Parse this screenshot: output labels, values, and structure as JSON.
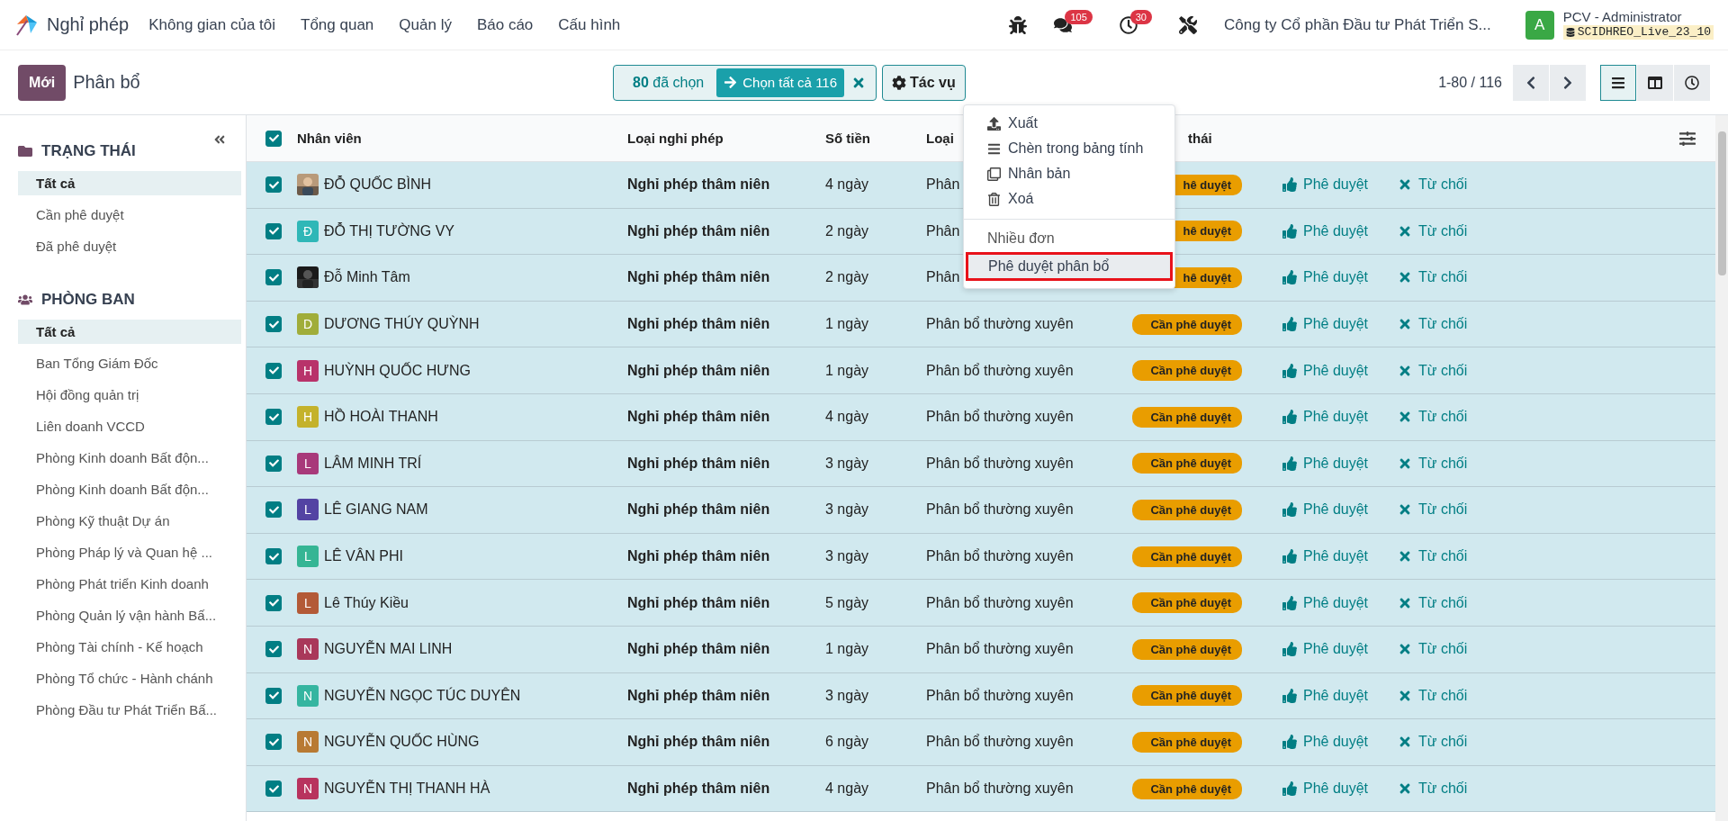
{
  "app": {
    "name": "Nghỉ phép"
  },
  "menu": [
    "Không gian của tôi",
    "Tổng quan",
    "Quản lý",
    "Báo cáo",
    "Cấu hình"
  ],
  "systray": {
    "messages_count": "105",
    "activities_count": "30",
    "company": "Công ty Cổ phần Đầu tư Phát Triển S...",
    "user_initial": "A",
    "user": "PCV - Administrator",
    "database": "SCIDHREO_Live_23_10"
  },
  "control": {
    "new_button": "Mới",
    "breadcrumb": "Phân bổ",
    "selected_count": "80",
    "selected_label": "đã chọn",
    "select_all": "Chọn tất cả 116",
    "actions": "Tác vụ",
    "pager": "1-80 / 116"
  },
  "views": [
    {
      "kind": "list",
      "selected": true
    },
    {
      "kind": "kanban",
      "selected": false
    },
    {
      "kind": "activity",
      "selected": false
    }
  ],
  "actions_menu": {
    "items": [
      {
        "kind": "export",
        "label": "Xuất",
        "highlighted": false
      },
      {
        "kind": "spreadsheet",
        "label": "Chèn trong bảng tính",
        "highlighted": false
      },
      {
        "kind": "duplicate",
        "label": "Nhân bản",
        "highlighted": false
      },
      {
        "kind": "delete",
        "label": "Xoá",
        "highlighted": false
      }
    ],
    "section": "Nhiều đơn",
    "section_items": [
      {
        "label": "Phê duyệt phân bổ",
        "highlighted": true
      }
    ]
  },
  "sidebar": {
    "groups": [
      {
        "kind": "folder",
        "title": "TRẠNG THÁI",
        "items": [
          {
            "label": "Tất cả",
            "selected": true
          },
          {
            "label": "Cần phê duyệt",
            "selected": false
          },
          {
            "label": "Đã phê duyệt",
            "selected": false
          }
        ]
      },
      {
        "kind": "users",
        "title": "PHÒNG BAN",
        "items": [
          {
            "label": "Tất cả",
            "selected": true
          },
          {
            "label": "Ban Tổng Giám Đốc",
            "selected": false
          },
          {
            "label": "Hội đồng quản trị",
            "selected": false
          },
          {
            "label": "Liên doanh VCCD",
            "selected": false
          },
          {
            "label": "Phòng Kinh doanh Bất độn...",
            "selected": false
          },
          {
            "label": "Phòng Kinh doanh Bất độn...",
            "selected": false
          },
          {
            "label": "Phòng Kỹ thuật Dự án",
            "selected": false
          },
          {
            "label": "Phòng Pháp lý và Quan hệ ...",
            "selected": false
          },
          {
            "label": "Phòng Phát triển Kinh doanh",
            "selected": false
          },
          {
            "label": "Phòng Quản lý vận hành Bấ...",
            "selected": false
          },
          {
            "label": "Phòng Tài chính - Kế hoạch",
            "selected": false
          },
          {
            "label": "Phòng Tổ chức - Hành chánh",
            "selected": false
          },
          {
            "label": "Phòng Đầu tư Phát Triển Bấ...",
            "selected": false
          }
        ]
      }
    ]
  },
  "table": {
    "header_checked": true,
    "columns": [
      "Nhân viên",
      "Loại nghỉ phép",
      "Số tiền",
      "Loại",
      "thái"
    ],
    "rows": [
      {
        "checked": true,
        "employee": "ĐỖ QUỐC BÌNH",
        "leave_type": "Nghỉ phép thâm niên",
        "amount": "4 ngày",
        "allocation_type": "Phân",
        "status": "hê duyệt",
        "approve": "Phê duyệt",
        "refuse": "Từ chối"
      },
      {
        "checked": true,
        "avatar": {
          "kind": "letter",
          "letter": "Đ",
          "color": "#2fb7b7"
        },
        "employee": "ĐỖ THỊ TƯỜNG VY",
        "leave_type": "Nghỉ phép thâm niên",
        "amount": "2 ngày",
        "allocation_type": "Phân",
        "status": "hê duyệt",
        "approve": "Phê duyệt",
        "refuse": "Từ chối"
      },
      {
        "checked": true,
        "employee": "Đỗ Minh Tâm",
        "leave_type": "Nghỉ phép thâm niên",
        "amount": "2 ngày",
        "allocation_type": "Phân",
        "status": "hê duyệt",
        "approve": "Phê duyệt",
        "refuse": "Từ chối"
      },
      {
        "checked": true,
        "avatar": {
          "kind": "letter",
          "letter": "D",
          "color": "#a0ad3a"
        },
        "employee": "DƯƠNG THÚY QUỲNH",
        "leave_type": "Nghỉ phép thâm niên",
        "amount": "1 ngày",
        "allocation_type": "Phân bổ thường xuyên",
        "status": "Cần phê duyệt",
        "approve": "Phê duyệt",
        "refuse": "Từ chối"
      },
      {
        "checked": true,
        "avatar": {
          "kind": "letter",
          "letter": "H",
          "color": "#b8336a"
        },
        "employee": "HUỲNH QUỐC HƯNG",
        "leave_type": "Nghỉ phép thâm niên",
        "amount": "1 ngày",
        "allocation_type": "Phân bổ thường xuyên",
        "status": "Cần phê duyệt",
        "approve": "Phê duyệt",
        "refuse": "Từ chối"
      },
      {
        "checked": true,
        "avatar": {
          "kind": "letter",
          "letter": "H",
          "color": "#c4b22b"
        },
        "employee": "HỒ HOÀI THANH",
        "leave_type": "Nghỉ phép thâm niên",
        "amount": "4 ngày",
        "allocation_type": "Phân bổ thường xuyên",
        "status": "Cần phê duyệt",
        "approve": "Phê duyệt",
        "refuse": "Từ chối"
      },
      {
        "checked": true,
        "avatar": {
          "kind": "letter",
          "letter": "L",
          "color": "#a8397a"
        },
        "employee": "LÂM MINH TRÍ",
        "leave_type": "Nghỉ phép thâm niên",
        "amount": "3 ngày",
        "allocation_type": "Phân bổ thường xuyên",
        "status": "Cần phê duyệt",
        "approve": "Phê duyệt",
        "refuse": "Từ chối"
      },
      {
        "checked": true,
        "avatar": {
          "kind": "letter",
          "letter": "L",
          "color": "#5343a3"
        },
        "employee": "LÊ GIANG NAM",
        "leave_type": "Nghỉ phép thâm niên",
        "amount": "3 ngày",
        "allocation_type": "Phân bổ thường xuyên",
        "status": "Cần phê duyệt",
        "approve": "Phê duyệt",
        "refuse": "Từ chối"
      },
      {
        "checked": true,
        "avatar": {
          "kind": "letter",
          "letter": "L",
          "color": "#35b594"
        },
        "employee": "LÊ VÂN PHI",
        "leave_type": "Nghỉ phép thâm niên",
        "amount": "3 ngày",
        "allocation_type": "Phân bổ thường xuyên",
        "status": "Cần phê duyệt",
        "approve": "Phê duyệt",
        "refuse": "Từ chối"
      },
      {
        "checked": true,
        "avatar": {
          "kind": "letter",
          "letter": "L",
          "color": "#b35a37"
        },
        "employee": "Lê Thúy Kiều",
        "leave_type": "Nghỉ phép thâm niên",
        "amount": "5 ngày",
        "allocation_type": "Phân bổ thường xuyên",
        "status": "Cần phê duyệt",
        "approve": "Phê duyệt",
        "refuse": "Từ chối"
      },
      {
        "checked": true,
        "avatar": {
          "kind": "letter",
          "letter": "N",
          "color": "#a9385a"
        },
        "employee": "NGUYỄN MAI LINH",
        "leave_type": "Nghỉ phép thâm niên",
        "amount": "1 ngày",
        "allocation_type": "Phân bổ thường xuyên",
        "status": "Cần phê duyệt",
        "approve": "Phê duyệt",
        "refuse": "Từ chối"
      },
      {
        "checked": true,
        "avatar": {
          "kind": "letter",
          "letter": "N",
          "color": "#35b5a0"
        },
        "employee": "NGUYỄN NGỌC TÚC DUYÊN",
        "leave_type": "Nghỉ phép thâm niên",
        "amount": "3 ngày",
        "allocation_type": "Phân bổ thường xuyên",
        "status": "Cần phê duyệt",
        "approve": "Phê duyệt",
        "refuse": "Từ chối"
      },
      {
        "checked": true,
        "avatar": {
          "kind": "letter",
          "letter": "N",
          "color": "#b87a33"
        },
        "employee": "NGUYỄN QUỐC HÙNG",
        "leave_type": "Nghỉ phép thâm niên",
        "amount": "6 ngày",
        "allocation_type": "Phân bổ thường xuyên",
        "status": "Cần phê duyệt",
        "approve": "Phê duyệt",
        "refuse": "Từ chối"
      },
      {
        "checked": true,
        "avatar": {
          "kind": "letter",
          "letter": "N",
          "color": "#b8335e"
        },
        "employee": "NGUYỄN THỊ THANH HÀ",
        "leave_type": "Nghỉ phép thâm niên",
        "amount": "4 ngày",
        "allocation_type": "Phân bổ thường xuyên",
        "status": "Cần phê duyệt",
        "approve": "Phê duyệt",
        "refuse": "Từ chối"
      }
    ]
  }
}
